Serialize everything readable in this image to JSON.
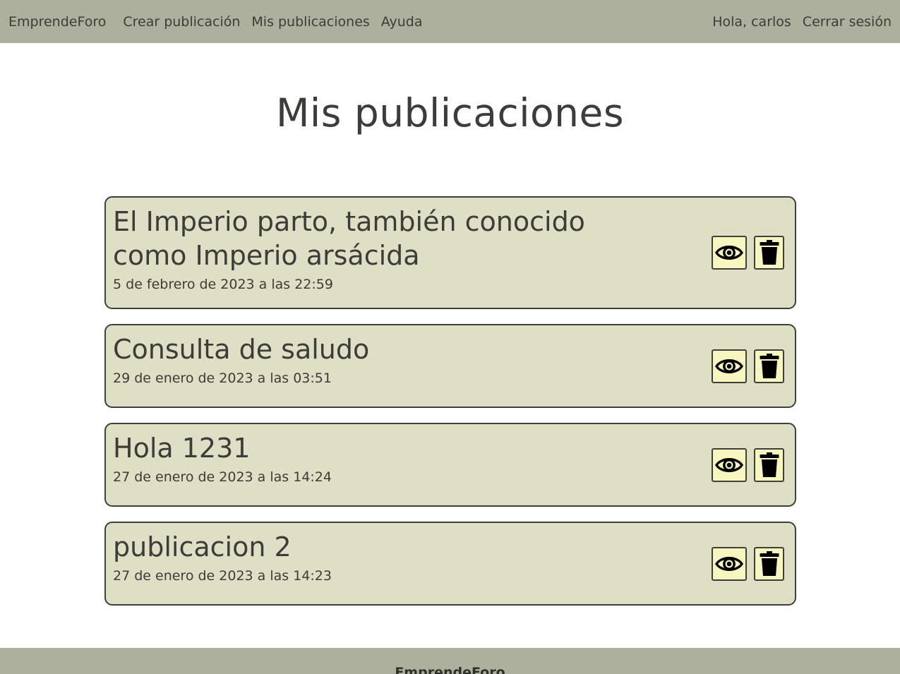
{
  "nav": {
    "brand": "EmprendeForo",
    "links": [
      "Crear publicación",
      "Mis publicaciones",
      "Ayuda"
    ],
    "greeting": "Hola, carlos",
    "logout": "Cerrar sesión"
  },
  "page": {
    "title": "Mis publicaciones"
  },
  "posts": [
    {
      "title": "El Imperio parto, también conocido como Imperio arsácida",
      "date": "5 de febrero de 2023 a las 22:59"
    },
    {
      "title": "Consulta de saludo",
      "date": "29 de enero de 2023 a las 03:51"
    },
    {
      "title": "Hola 1231",
      "date": "27 de enero de 2023 a las 14:24"
    },
    {
      "title": "publicacion 2",
      "date": "27 de enero de 2023 a las 14:23"
    }
  ],
  "icons": {
    "view": "eye-icon",
    "delete": "trash-icon"
  },
  "colors": {
    "navbar": "#adb09d",
    "card": "#dfdfc5",
    "button": "#f7f6c0",
    "text": "#3a3d38"
  },
  "footer": {
    "brand": "EmprendeForo"
  }
}
